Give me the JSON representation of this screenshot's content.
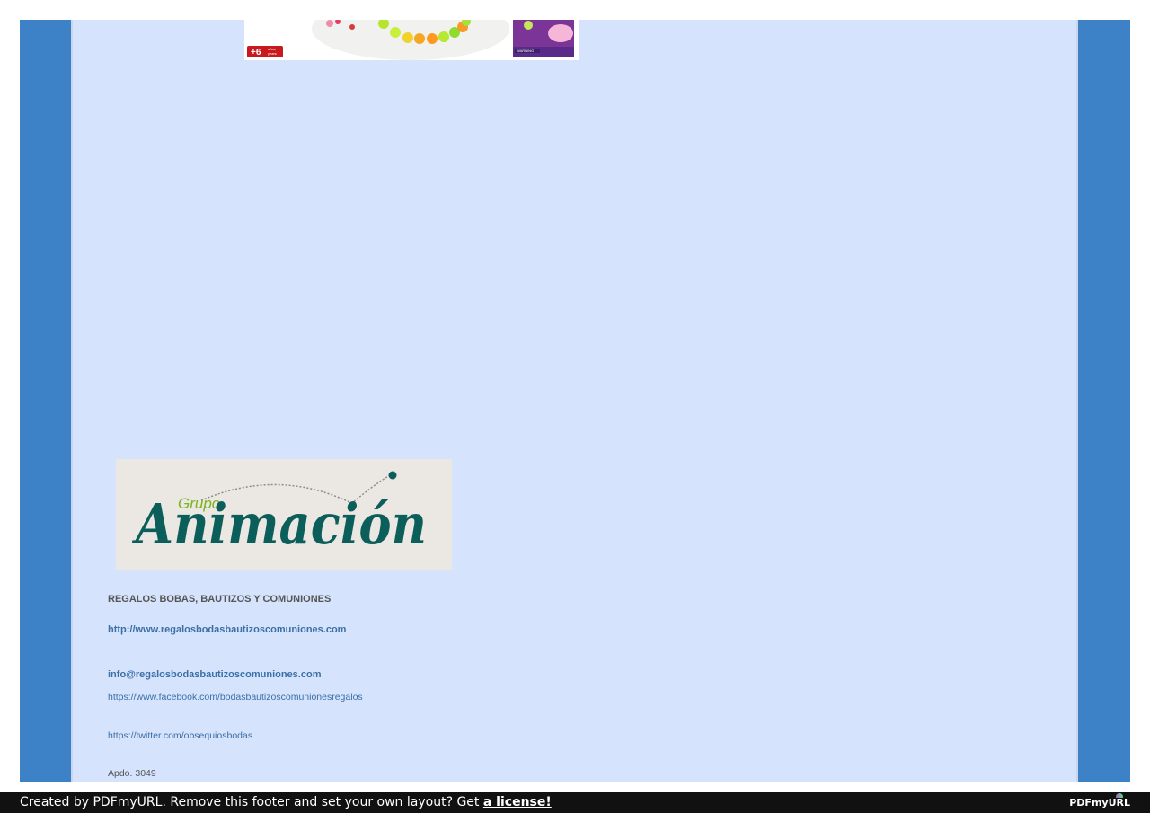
{
  "product": {
    "age_badge": "+6",
    "age_sub_1": "años",
    "age_sub_2": "years",
    "box_warning": "WARNING"
  },
  "logo": {
    "small_word": "Grupo",
    "big_word": "Animación"
  },
  "contact": {
    "company": "REGALOS BOBAS, BAUTIZOS Y COMUNIONES",
    "website": "http://www.regalosbodasbautizoscomuniones.com",
    "email": "info@regalosbodasbautizoscomuniones.com",
    "facebook": "https://www.facebook.com/bodasbautizoscomunionesregalos",
    "twitter": "https://twitter.com/obsequiosbodas",
    "apdo": "Apdo. 3049"
  },
  "footer": {
    "text": "Created by PDFmyURL. Remove this footer and set your own layout? Get ",
    "link": "a license!",
    "brand": "PDFmyURL"
  },
  "colors": {
    "side_blue": "#3d82c6",
    "content_bg": "#d5e3fc",
    "link_blue": "#3a6fa7",
    "logo_green": "#7ab51d",
    "logo_teal": "#0b5e5a"
  }
}
